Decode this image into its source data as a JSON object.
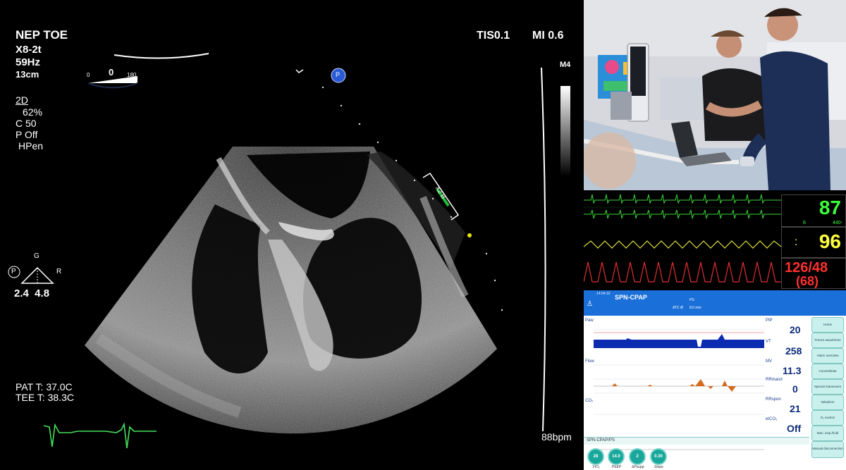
{
  "echo": {
    "mode": "NEP TOE",
    "probe": "X8-2t",
    "frame_rate": "59Hz",
    "depth": "13cm",
    "tis": "TIS0.1",
    "mi": "MI 0.6",
    "angle_min": "0",
    "angle_value": "0",
    "angle_max": "180",
    "grayscale_map": "M4",
    "mode_2d": "2D",
    "gain": "62%",
    "compress": "C 50",
    "persist": "P Off",
    "harmonic": "HPen",
    "focus_g": "G",
    "focus_p": "P",
    "focus_r": "R",
    "focus_values": "2.4  4.8",
    "marker_label": "X2 B",
    "probe_badge": "P",
    "pat_temp": "PAT T: 37.0C",
    "tee_temp": "TEE T: 38.3C",
    "heart_rate": "88bpm"
  },
  "vitals": {
    "hr": "87",
    "hr_sub1": "6",
    "hr_sub2": "440-",
    "spo2": "96",
    "spo2_marker": ":",
    "bp": "126/48",
    "map": "(68)",
    "colors": {
      "hr": "#3cff3c",
      "spo2": "#ffff40",
      "bp": "#ff3030"
    }
  },
  "vent": {
    "time": "14:04:10",
    "mode_title": "SPN-CPAP",
    "sub_label": "PS",
    "atc": "ATC Ø",
    "atc_value": "8.0 mm",
    "pip_label": "PIP",
    "pip_value": "20",
    "vt_label": "VT",
    "vt_value": "258",
    "mv_label": "MV",
    "mv_value": "11.3",
    "rrmand_label": "RRmand",
    "rrmand_value": "0",
    "rrspon_label": "RRspon",
    "rrspon_value": "21",
    "etco2_label": "etCO₂",
    "etco2_value": "Off",
    "plot_labels": [
      "Paw",
      "Flow",
      "CO₂"
    ],
    "mode_bar": "SPN-CPAP/PS",
    "buttons": [
      "Home",
      "Freeze waveforms",
      "Alarm overview",
      "Curves/Data",
      "Special maneuvers",
      "Nebulizer",
      "O₂ suction",
      "Man. insp./hold",
      "Manual disconnection"
    ],
    "dials": [
      {
        "value": "28",
        "label": "FiO₂"
      },
      {
        "value": "14.0",
        "label": "PEEP"
      },
      {
        "value": "2",
        "label": "ΔPsupp"
      },
      {
        "value": "0.30",
        "label": "Slope"
      }
    ],
    "accent": "#1a6fd8"
  }
}
